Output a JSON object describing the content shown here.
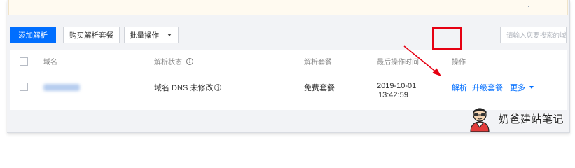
{
  "toolbar": {
    "add_label": "添加解析",
    "buy_label": "购买解析套餐",
    "batch_label": "批量操作"
  },
  "search": {
    "placeholder": "请输入您要搜索的域"
  },
  "table": {
    "headers": {
      "domain": "域名",
      "status": "解析状态",
      "package": "解析套餐",
      "last_op_time": "最后操作时间",
      "actions": "操作"
    },
    "rows": [
      {
        "status": "域名 DNS 未修改",
        "package": "免费套餐",
        "date": "2019-10-01",
        "time": "13:42:59",
        "action_resolve": "解析",
        "action_upgrade": "升级套餐",
        "action_more": "更多"
      }
    ]
  },
  "watermark": {
    "text": "奶爸建站笔记"
  },
  "colors": {
    "primary": "#006eff",
    "highlight": "#e60012",
    "annotation_arrow": "#e60012"
  },
  "icons": {
    "info": "info-circle-icon",
    "dropdown": "chevron-down-icon",
    "watermark_avatar": "cartoon-avatar-icon"
  }
}
